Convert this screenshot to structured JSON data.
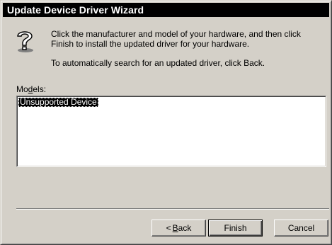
{
  "window": {
    "title": "Update Device Driver Wizard"
  },
  "intro": {
    "line1": "Click the manufacturer and model of your hardware, and then click Finish to install the updated driver for your hardware.",
    "line2": "To automatically search for an updated driver, click Back."
  },
  "models": {
    "label_prefix": "Mo",
    "label_accel": "d",
    "label_suffix": "els:",
    "items": [
      "Unsupported Device"
    ],
    "selected_index": 0
  },
  "buttons": {
    "back_arrow": "<",
    "back_accel": "B",
    "back_rest": "ack",
    "finish": "Finish",
    "cancel": "Cancel"
  },
  "icons": {
    "help": "question-mark-help-icon"
  }
}
